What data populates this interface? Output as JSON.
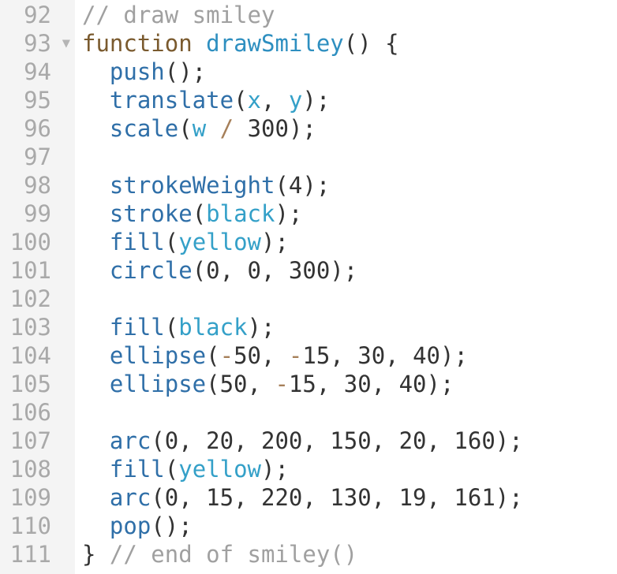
{
  "editor": {
    "lines": [
      {
        "num": "92",
        "tokens": [
          {
            "t": "// draw smiley",
            "c": "comment"
          }
        ]
      },
      {
        "num": "93",
        "fold": "▼",
        "tokens": [
          {
            "t": "function",
            "c": "keyword"
          },
          {
            "t": " ",
            "c": "punct"
          },
          {
            "t": "drawSmiley",
            "c": "fname"
          },
          {
            "t": "() {",
            "c": "punct"
          }
        ]
      },
      {
        "num": "94",
        "tokens": [
          {
            "t": "  ",
            "c": "punct"
          },
          {
            "t": "push",
            "c": "call"
          },
          {
            "t": "();",
            "c": "punct"
          }
        ]
      },
      {
        "num": "95",
        "tokens": [
          {
            "t": "  ",
            "c": "punct"
          },
          {
            "t": "translate",
            "c": "call"
          },
          {
            "t": "(",
            "c": "punct"
          },
          {
            "t": "x",
            "c": "var"
          },
          {
            "t": ", ",
            "c": "punct"
          },
          {
            "t": "y",
            "c": "var"
          },
          {
            "t": ");",
            "c": "punct"
          }
        ]
      },
      {
        "num": "96",
        "tokens": [
          {
            "t": "  ",
            "c": "punct"
          },
          {
            "t": "scale",
            "c": "call"
          },
          {
            "t": "(",
            "c": "punct"
          },
          {
            "t": "w",
            "c": "var"
          },
          {
            "t": " ",
            "c": "punct"
          },
          {
            "t": "/",
            "c": "op"
          },
          {
            "t": " 300);",
            "c": "punct"
          }
        ]
      },
      {
        "num": "97",
        "tokens": []
      },
      {
        "num": "98",
        "tokens": [
          {
            "t": "  ",
            "c": "punct"
          },
          {
            "t": "strokeWeight",
            "c": "call"
          },
          {
            "t": "(4);",
            "c": "punct"
          }
        ]
      },
      {
        "num": "99",
        "tokens": [
          {
            "t": "  ",
            "c": "punct"
          },
          {
            "t": "stroke",
            "c": "call"
          },
          {
            "t": "(",
            "c": "punct"
          },
          {
            "t": "black",
            "c": "var"
          },
          {
            "t": ");",
            "c": "punct"
          }
        ]
      },
      {
        "num": "100",
        "tokens": [
          {
            "t": "  ",
            "c": "punct"
          },
          {
            "t": "fill",
            "c": "call"
          },
          {
            "t": "(",
            "c": "punct"
          },
          {
            "t": "yellow",
            "c": "var"
          },
          {
            "t": ");",
            "c": "punct"
          }
        ]
      },
      {
        "num": "101",
        "tokens": [
          {
            "t": "  ",
            "c": "punct"
          },
          {
            "t": "circle",
            "c": "call"
          },
          {
            "t": "(0, 0, 300);",
            "c": "punct"
          }
        ]
      },
      {
        "num": "102",
        "tokens": []
      },
      {
        "num": "103",
        "tokens": [
          {
            "t": "  ",
            "c": "punct"
          },
          {
            "t": "fill",
            "c": "call"
          },
          {
            "t": "(",
            "c": "punct"
          },
          {
            "t": "black",
            "c": "var"
          },
          {
            "t": ");",
            "c": "punct"
          }
        ]
      },
      {
        "num": "104",
        "tokens": [
          {
            "t": "  ",
            "c": "punct"
          },
          {
            "t": "ellipse",
            "c": "call"
          },
          {
            "t": "(",
            "c": "punct"
          },
          {
            "t": "-",
            "c": "op"
          },
          {
            "t": "50, ",
            "c": "punct"
          },
          {
            "t": "-",
            "c": "op"
          },
          {
            "t": "15, 30, 40);",
            "c": "punct"
          }
        ]
      },
      {
        "num": "105",
        "tokens": [
          {
            "t": "  ",
            "c": "punct"
          },
          {
            "t": "ellipse",
            "c": "call"
          },
          {
            "t": "(50, ",
            "c": "punct"
          },
          {
            "t": "-",
            "c": "op"
          },
          {
            "t": "15, 30, 40);",
            "c": "punct"
          }
        ]
      },
      {
        "num": "106",
        "tokens": []
      },
      {
        "num": "107",
        "tokens": [
          {
            "t": "  ",
            "c": "punct"
          },
          {
            "t": "arc",
            "c": "call"
          },
          {
            "t": "(0, 20, 200, 150, 20, 160);",
            "c": "punct"
          }
        ]
      },
      {
        "num": "108",
        "tokens": [
          {
            "t": "  ",
            "c": "punct"
          },
          {
            "t": "fill",
            "c": "call"
          },
          {
            "t": "(",
            "c": "punct"
          },
          {
            "t": "yellow",
            "c": "var"
          },
          {
            "t": ");",
            "c": "punct"
          }
        ]
      },
      {
        "num": "109",
        "tokens": [
          {
            "t": "  ",
            "c": "punct"
          },
          {
            "t": "arc",
            "c": "call"
          },
          {
            "t": "(0, 15, 220, 130, 19, 161);",
            "c": "punct"
          }
        ]
      },
      {
        "num": "110",
        "tokens": [
          {
            "t": "  ",
            "c": "punct"
          },
          {
            "t": "pop",
            "c": "call"
          },
          {
            "t": "();",
            "c": "punct"
          }
        ]
      },
      {
        "num": "111",
        "tokens": [
          {
            "t": "} ",
            "c": "punct"
          },
          {
            "t": "// end of smiley()",
            "c": "comment"
          }
        ]
      }
    ]
  }
}
